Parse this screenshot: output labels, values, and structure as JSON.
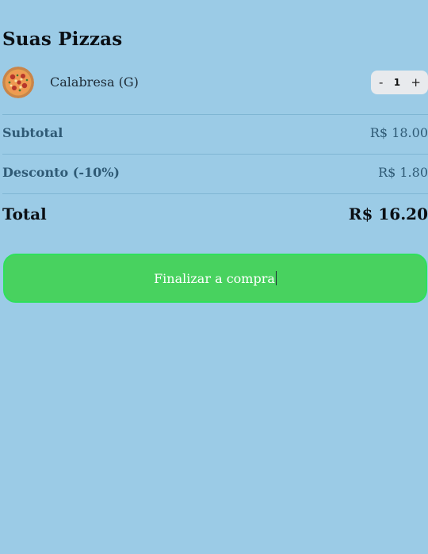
{
  "cart": {
    "title": "Suas Pizzas",
    "items": [
      {
        "name": "Calabresa (G)",
        "quantity": "1",
        "decrement_label": "-",
        "increment_label": "+",
        "thumbnail_icon": "pizza-icon"
      }
    ]
  },
  "summary": {
    "subtotal_label": "Subtotal",
    "subtotal_value": "R$ 18.00",
    "discount_label": "Desconto (-10%)",
    "discount_value": "R$ 1.80",
    "total_label": "Total",
    "total_value": "R$ 16.20"
  },
  "checkout": {
    "button_label": "Finalizar a compra"
  },
  "colors": {
    "background": "#9bcbe6",
    "checkout_button": "#48d25f",
    "checkout_border": "#2fe05b",
    "summary_text": "#2f5a75"
  }
}
